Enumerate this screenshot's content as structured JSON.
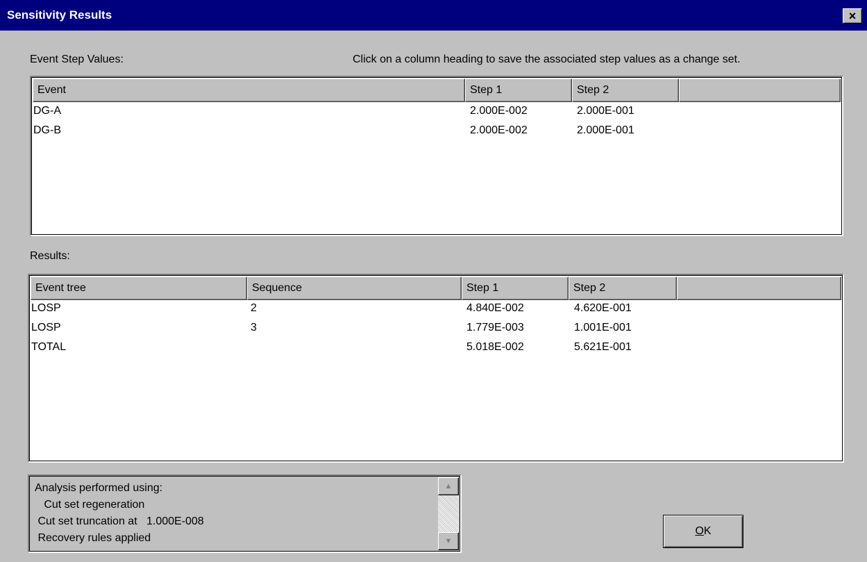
{
  "window": {
    "title": "Sensitivity Results",
    "close_symbol": "×"
  },
  "event_step": {
    "label": "Event Step Values:",
    "instruction": "Click on a column heading to save the associated step values as a change set.",
    "columns": [
      "Event",
      "Step 1",
      "Step 2"
    ],
    "rows": [
      [
        "DG-A",
        "2.000E-002",
        "2.000E-001"
      ],
      [
        "DG-B",
        "2.000E-002",
        "2.000E-001"
      ]
    ]
  },
  "results": {
    "label": "Results:",
    "columns": [
      "Event tree",
      "Sequence",
      "Step 1",
      "Step 2"
    ],
    "rows": [
      [
        "LOSP",
        "2",
        "4.840E-002",
        "4.620E-001"
      ],
      [
        "LOSP",
        "3",
        "1.779E-003",
        "1.001E-001"
      ],
      [
        "TOTAL",
        "",
        "5.018E-002",
        "5.621E-001"
      ]
    ]
  },
  "analysis": {
    "lines": [
      "Analysis performed using:",
      "   Cut set regeneration",
      " Cut set truncation at   1.000E-008",
      " Recovery rules applied"
    ]
  },
  "ok_button": {
    "label": "OK",
    "mnemonic": "O",
    "rest": "K"
  },
  "icons": {
    "close": "close-icon",
    "scroll_up": "arrow-up-icon",
    "scroll_down": "arrow-down-icon"
  }
}
